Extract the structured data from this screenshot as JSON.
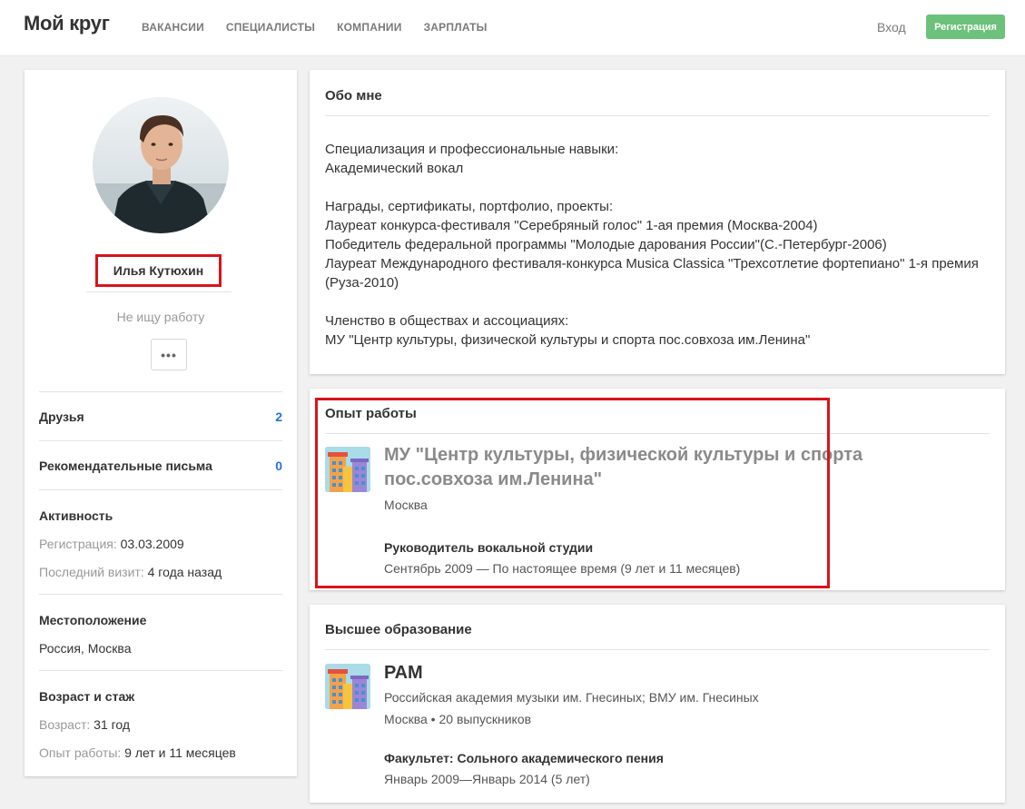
{
  "header": {
    "logo": "Мой круг",
    "nav": [
      "ВАКАНСИИ",
      "СПЕЦИАЛИСТЫ",
      "КОМПАНИИ",
      "ЗАРПЛАТЫ"
    ],
    "login": "Вход",
    "register": "Регистрация",
    "register_color": "#6cc27a"
  },
  "profile": {
    "name": "Илья Кутюхин",
    "status": "Не ищу работу",
    "more": "•••",
    "friends_label": "Друзья",
    "friends_count": "2",
    "recs_label": "Рекомендательные письма",
    "recs_count": "0",
    "activity": {
      "title": "Активность",
      "reg_label": "Регистрация:",
      "reg_value": "03.03.2009",
      "visit_label": "Последний визит:",
      "visit_value": "4 года назад"
    },
    "location": {
      "title": "Местоположение",
      "value": "Россия, Москва"
    },
    "age": {
      "title": "Возраст и стаж",
      "age_label": "Возраст:",
      "age_value": "31 год",
      "exp_label": "Опыт работы:",
      "exp_value": "9 лет и 11 месяцев"
    }
  },
  "about": {
    "title": "Обо мне",
    "spec_label": "Специализация и профессиональные навыки:",
    "spec_value": "Академический вокал",
    "awards_label": "Награды, сертификаты, портфолио, проекты:",
    "awards": [
      "Лауреат конкурса-фестиваля \"Серебряный голос\" 1-ая премия (Москва-2004)",
      "Победитель федеральной программы \"Молодые дарования России\"(С.-Петербург-2006)",
      "Лауреат Международного фестиваля-конкурса Musica Classica \"Трехсотлетие фортепиано\" 1-я премия (Руза-2010)"
    ],
    "membership_label": "Членство в обществах и ассоциациях:",
    "membership_value": "МУ \"Центр культуры, физической культуры и спорта пос.совхоза им.Ленина\""
  },
  "experience": {
    "title": "Опыт работы",
    "org_line1": "МУ \"Центр культуры, физической культуры и спорта",
    "org_line2": "пос.совхоза им.Ленина\"",
    "city": "Москва",
    "position": "Руководитель вокальной студии",
    "period": "Сентябрь 2009 — По настоящее время (9 лет и 11 месяцев)",
    "highlight_color": "#d8141b"
  },
  "education": {
    "title": "Высшее образование",
    "org": "РАМ",
    "full_name": "Российская академия музыки им. Гнесиных; ВМУ им. Гнесиных",
    "meta": "Москва • 20 выпускников",
    "faculty": "Факультет: Сольного академического пения",
    "period": "Январь 2009—Январь 2014 (5 лет)"
  }
}
